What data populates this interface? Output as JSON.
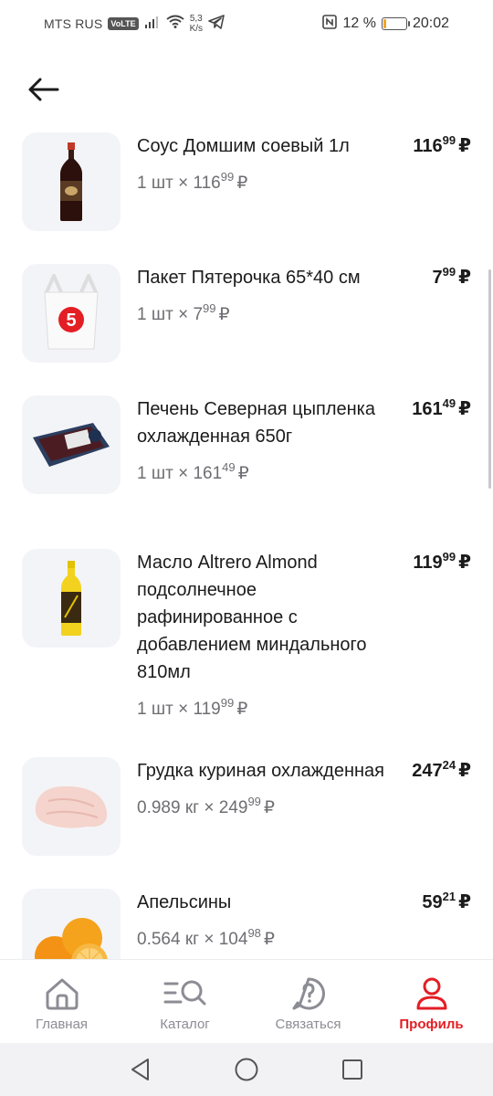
{
  "status_bar": {
    "carrier": "MTS RUS",
    "volte": "VoLTE",
    "speed_value": "5,3",
    "speed_unit": "K/s",
    "battery_percent": "12 %",
    "battery_level": 0.12,
    "time": "20:02"
  },
  "items": [
    {
      "name": "Соус Домшим соевый 1л",
      "qty_prefix": "1 шт × ",
      "unit_int": "116",
      "unit_cents": "99",
      "price_int": "116",
      "price_cents": "99",
      "currency": "₽",
      "image": "soy-sauce-bottle"
    },
    {
      "name": "Пакет Пятерочка 65*40 см",
      "qty_prefix": "1 шт × ",
      "unit_int": "7",
      "unit_cents": "99",
      "price_int": "7",
      "price_cents": "99",
      "currency": "₽",
      "image": "plastic-bag-5"
    },
    {
      "name": "Печень Северная цыпленка охлажденная 650г",
      "qty_prefix": "1 шт × ",
      "unit_int": "161",
      "unit_cents": "49",
      "price_int": "161",
      "price_cents": "49",
      "currency": "₽",
      "image": "liver-tray"
    },
    {
      "name": "Масло Altrero Almond подсолнечное рафинированное с добавлением миндального 810мл",
      "qty_prefix": "1 шт × ",
      "unit_int": "119",
      "unit_cents": "99",
      "price_int": "119",
      "price_cents": "99",
      "currency": "₽",
      "image": "oil-bottle"
    },
    {
      "name": "Грудка куриная охлажденная",
      "qty_prefix": "0.989 кг × ",
      "unit_int": "249",
      "unit_cents": "99",
      "price_int": "247",
      "price_cents": "24",
      "currency": "₽",
      "image": "chicken-breast"
    },
    {
      "name": "Апельсины",
      "qty_prefix": "0.564 кг × ",
      "unit_int": "104",
      "unit_cents": "98",
      "price_int": "59",
      "price_cents": "21",
      "currency": "₽",
      "image": "oranges"
    }
  ],
  "bottom_nav": [
    {
      "label": "Главная",
      "icon": "home-icon",
      "active": false
    },
    {
      "label": "Каталог",
      "icon": "catalog-search-icon",
      "active": false
    },
    {
      "label": "Связаться",
      "icon": "help-icon",
      "active": false
    },
    {
      "label": "Профиль",
      "icon": "profile-icon",
      "active": true
    }
  ],
  "colors": {
    "accent": "#e31e24",
    "text": "#1b1b1b",
    "secondary": "#6e6e73",
    "thumb_bg": "#f3f4f7"
  }
}
